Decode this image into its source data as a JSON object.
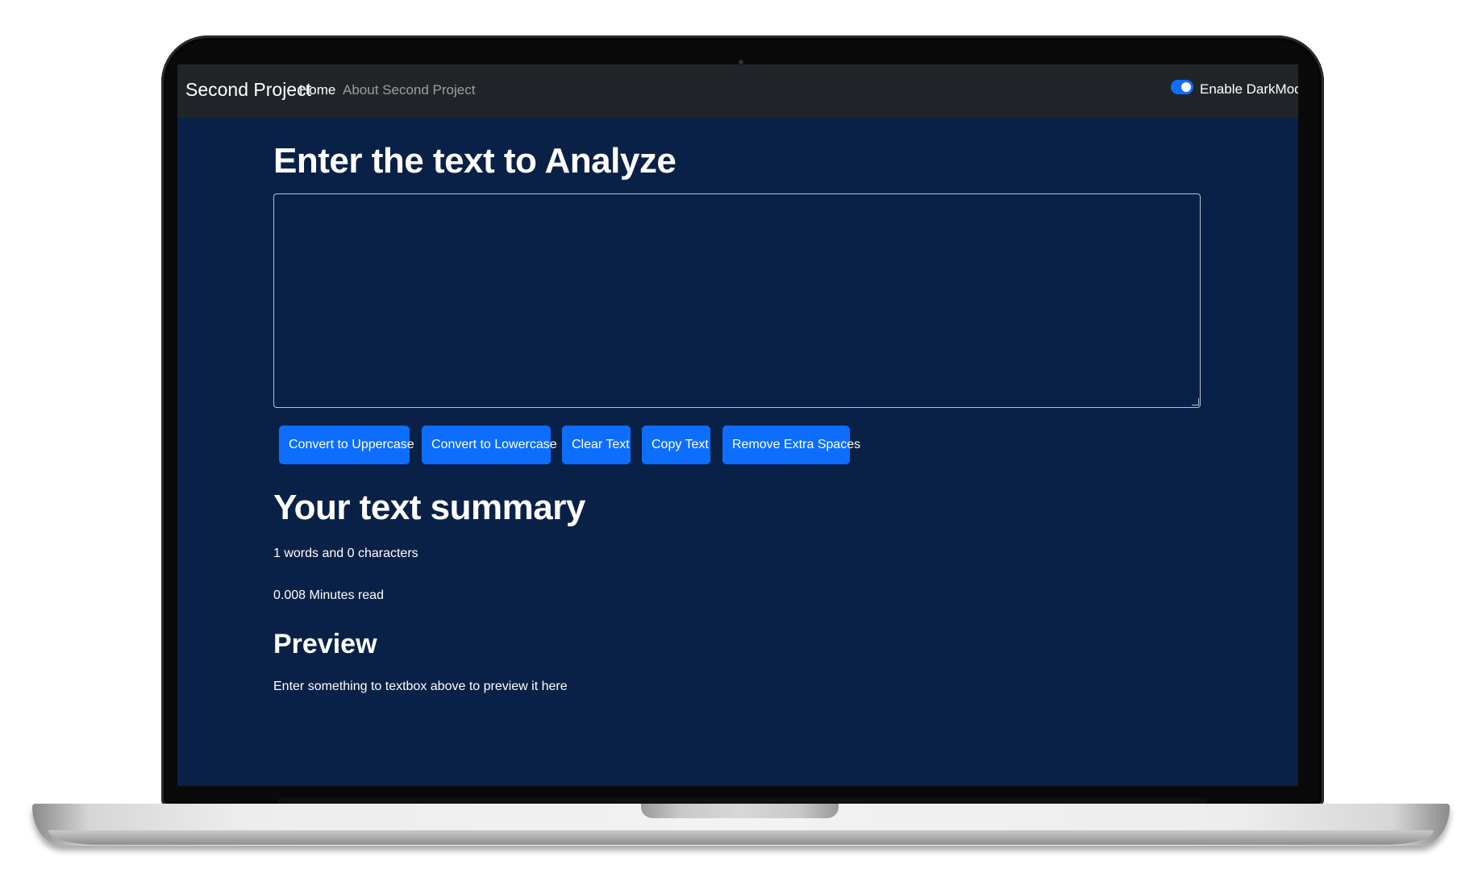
{
  "navbar": {
    "brand": "Second Project",
    "links": [
      {
        "label": "Home",
        "active": true
      },
      {
        "label": "About Second Project",
        "active": false
      }
    ],
    "darkmode_toggle": {
      "label": "Enable DarkMode",
      "checked": true
    }
  },
  "main": {
    "heading": "Enter the text to Analyze",
    "textbox": {
      "value": "",
      "placeholder": ""
    },
    "buttons": {
      "uppercase": "Convert to Uppercase",
      "lowercase": "Convert to Lowercase",
      "clear": "Clear Text",
      "copy": "Copy Text",
      "remove_spaces": "Remove Extra Spaces"
    }
  },
  "summary": {
    "heading": "Your text summary",
    "counts": "1 words and 0 characters",
    "read_time": "0.008 Minutes read"
  },
  "preview": {
    "heading": "Preview",
    "text": "Enter something to textbox above to preview it here"
  },
  "colors": {
    "screen_background": "#0a2147",
    "navbar_background": "#212529",
    "button_primary": "#0d6efd",
    "text": "#ffffff"
  }
}
